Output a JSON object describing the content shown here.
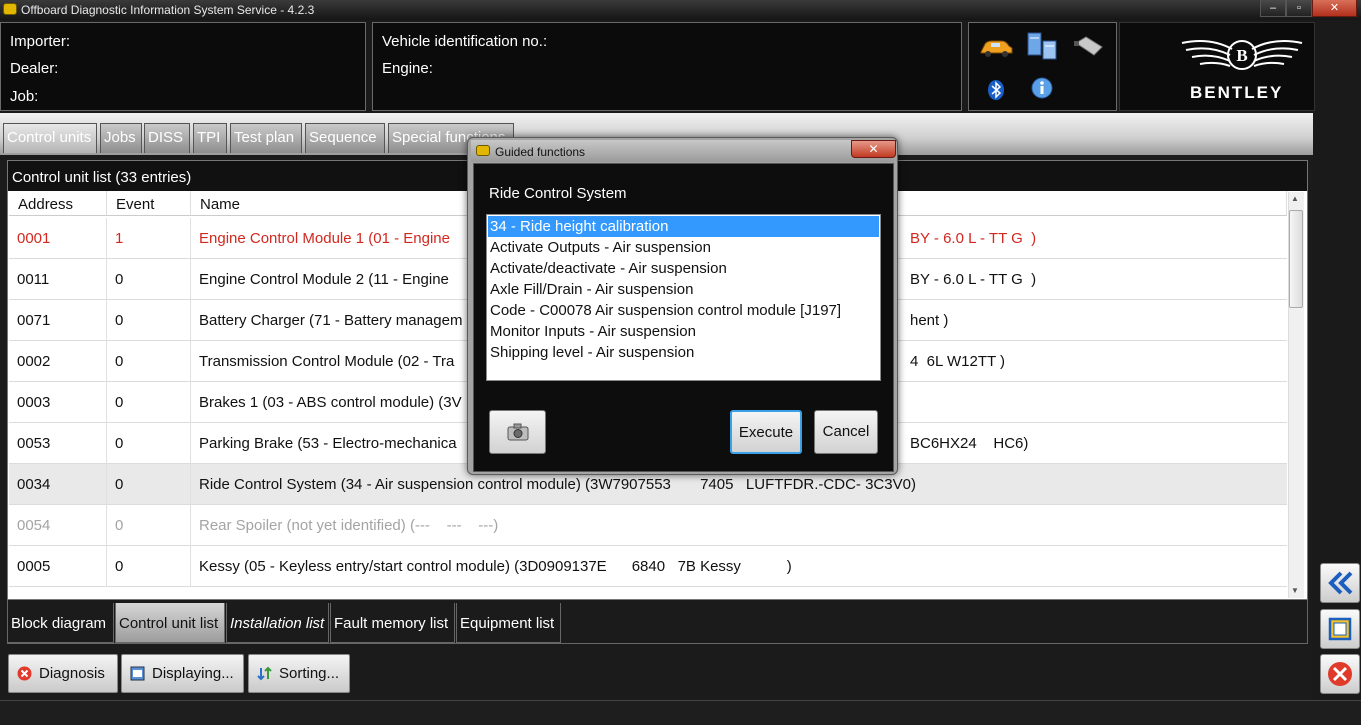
{
  "window": {
    "title": "Offboard Diagnostic Information System Service - 4.2.3",
    "minimize": "–",
    "maximize": "▫",
    "close": "✕"
  },
  "header": {
    "importer_label": "Importer:",
    "dealer_label": "Dealer:",
    "job_label": "Job:",
    "vin_label": "Vehicle identification no.:",
    "engine_label": "Engine:",
    "brand": "BENTLEY",
    "icons": [
      "car-icon",
      "network-icon",
      "connector-icon",
      "bluetooth-icon",
      "info-icon"
    ]
  },
  "tabs": [
    "Control units",
    "Jobs",
    "DISS",
    "TPI",
    "Test plan",
    "Sequence",
    "Special functions"
  ],
  "list": {
    "caption": "Control unit list (33 entries)",
    "columns": [
      "Address",
      "Event",
      "Name"
    ],
    "rows": [
      {
        "address": "0001",
        "event": "1",
        "name": "Engine Control Module 1 (01 - Engine",
        "suffix": "BY - 6.0 L - TT G  )"
      },
      {
        "address": "0011",
        "event": "0",
        "name": "Engine Control Module 2 (11 - Engine",
        "suffix": "BY - 6.0 L - TT G  )"
      },
      {
        "address": "0071",
        "event": "0",
        "name": "Battery Charger (71 - Battery managem",
        "suffix": "hent )"
      },
      {
        "address": "0002",
        "event": "0",
        "name": "Transmission Control Module (02 - Tra",
        "suffix": "4  6L W12TT )"
      },
      {
        "address": "0003",
        "event": "0",
        "name": "Brakes 1 (03 - ABS control module) (3V",
        "suffix": ""
      },
      {
        "address": "0053",
        "event": "0",
        "name": "Parking Brake (53 - Electro-mechanica",
        "suffix": "BC6HX24    HC6)"
      },
      {
        "address": "0034",
        "event": "0",
        "name": "Ride Control System (34 - Air suspension control module) (3W7907553       7405   LUFTFDR.-CDC- 3C3V0)",
        "suffix": ""
      },
      {
        "address": "0054",
        "event": "0",
        "name": "Rear Spoiler (not yet identified) (---    ---    ---)",
        "suffix": ""
      },
      {
        "address": "0005",
        "event": "0",
        "name": "Kessy (05 - Keyless entry/start control module) (3D0909137E      6840   7B Kessy           )",
        "suffix": ""
      }
    ]
  },
  "subtabs": [
    "Block diagram",
    "Control unit list",
    "Installation list",
    "Fault memory list",
    "Equipment list"
  ],
  "buttons": {
    "diagnosis": "Diagnosis",
    "displaying": "Displaying...",
    "sorting": "Sorting..."
  },
  "dialog": {
    "title": "Guided functions",
    "heading": "Ride Control System",
    "items": [
      "34 - Ride height calibration",
      "Activate Outputs - Air suspension",
      "Activate/deactivate - Air suspension",
      "Axle Fill/Drain - Air suspension",
      "Code - C00078 Air suspension control module [J197]",
      "Monitor Inputs - Air suspension",
      "Shipping level - Air suspension"
    ],
    "execute": "Execute",
    "cancel": "Cancel"
  }
}
